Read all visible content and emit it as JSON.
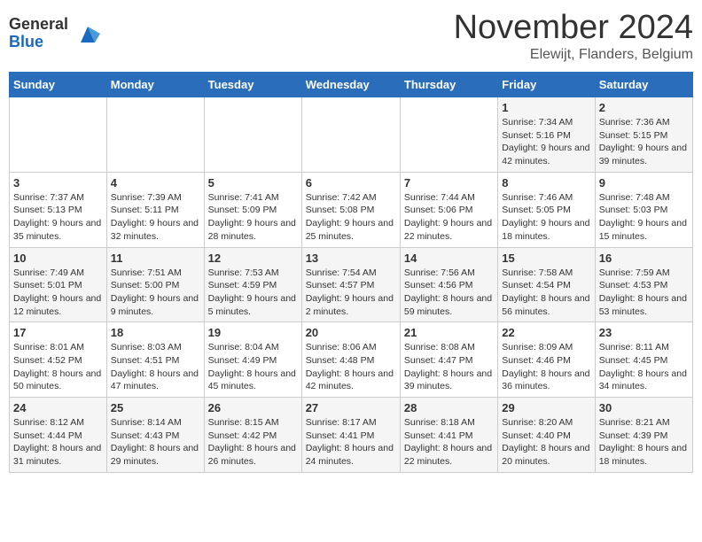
{
  "logo": {
    "text_general": "General",
    "text_blue": "Blue"
  },
  "header": {
    "month_year": "November 2024",
    "location": "Elewijt, Flanders, Belgium"
  },
  "weekdays": [
    "Sunday",
    "Monday",
    "Tuesday",
    "Wednesday",
    "Thursday",
    "Friday",
    "Saturday"
  ],
  "weeks": [
    [
      {
        "day": "",
        "info": ""
      },
      {
        "day": "",
        "info": ""
      },
      {
        "day": "",
        "info": ""
      },
      {
        "day": "",
        "info": ""
      },
      {
        "day": "",
        "info": ""
      },
      {
        "day": "1",
        "info": "Sunrise: 7:34 AM\nSunset: 5:16 PM\nDaylight: 9 hours and 42 minutes."
      },
      {
        "day": "2",
        "info": "Sunrise: 7:36 AM\nSunset: 5:15 PM\nDaylight: 9 hours and 39 minutes."
      }
    ],
    [
      {
        "day": "3",
        "info": "Sunrise: 7:37 AM\nSunset: 5:13 PM\nDaylight: 9 hours and 35 minutes."
      },
      {
        "day": "4",
        "info": "Sunrise: 7:39 AM\nSunset: 5:11 PM\nDaylight: 9 hours and 32 minutes."
      },
      {
        "day": "5",
        "info": "Sunrise: 7:41 AM\nSunset: 5:09 PM\nDaylight: 9 hours and 28 minutes."
      },
      {
        "day": "6",
        "info": "Sunrise: 7:42 AM\nSunset: 5:08 PM\nDaylight: 9 hours and 25 minutes."
      },
      {
        "day": "7",
        "info": "Sunrise: 7:44 AM\nSunset: 5:06 PM\nDaylight: 9 hours and 22 minutes."
      },
      {
        "day": "8",
        "info": "Sunrise: 7:46 AM\nSunset: 5:05 PM\nDaylight: 9 hours and 18 minutes."
      },
      {
        "day": "9",
        "info": "Sunrise: 7:48 AM\nSunset: 5:03 PM\nDaylight: 9 hours and 15 minutes."
      }
    ],
    [
      {
        "day": "10",
        "info": "Sunrise: 7:49 AM\nSunset: 5:01 PM\nDaylight: 9 hours and 12 minutes."
      },
      {
        "day": "11",
        "info": "Sunrise: 7:51 AM\nSunset: 5:00 PM\nDaylight: 9 hours and 9 minutes."
      },
      {
        "day": "12",
        "info": "Sunrise: 7:53 AM\nSunset: 4:59 PM\nDaylight: 9 hours and 5 minutes."
      },
      {
        "day": "13",
        "info": "Sunrise: 7:54 AM\nSunset: 4:57 PM\nDaylight: 9 hours and 2 minutes."
      },
      {
        "day": "14",
        "info": "Sunrise: 7:56 AM\nSunset: 4:56 PM\nDaylight: 8 hours and 59 minutes."
      },
      {
        "day": "15",
        "info": "Sunrise: 7:58 AM\nSunset: 4:54 PM\nDaylight: 8 hours and 56 minutes."
      },
      {
        "day": "16",
        "info": "Sunrise: 7:59 AM\nSunset: 4:53 PM\nDaylight: 8 hours and 53 minutes."
      }
    ],
    [
      {
        "day": "17",
        "info": "Sunrise: 8:01 AM\nSunset: 4:52 PM\nDaylight: 8 hours and 50 minutes."
      },
      {
        "day": "18",
        "info": "Sunrise: 8:03 AM\nSunset: 4:51 PM\nDaylight: 8 hours and 47 minutes."
      },
      {
        "day": "19",
        "info": "Sunrise: 8:04 AM\nSunset: 4:49 PM\nDaylight: 8 hours and 45 minutes."
      },
      {
        "day": "20",
        "info": "Sunrise: 8:06 AM\nSunset: 4:48 PM\nDaylight: 8 hours and 42 minutes."
      },
      {
        "day": "21",
        "info": "Sunrise: 8:08 AM\nSunset: 4:47 PM\nDaylight: 8 hours and 39 minutes."
      },
      {
        "day": "22",
        "info": "Sunrise: 8:09 AM\nSunset: 4:46 PM\nDaylight: 8 hours and 36 minutes."
      },
      {
        "day": "23",
        "info": "Sunrise: 8:11 AM\nSunset: 4:45 PM\nDaylight: 8 hours and 34 minutes."
      }
    ],
    [
      {
        "day": "24",
        "info": "Sunrise: 8:12 AM\nSunset: 4:44 PM\nDaylight: 8 hours and 31 minutes."
      },
      {
        "day": "25",
        "info": "Sunrise: 8:14 AM\nSunset: 4:43 PM\nDaylight: 8 hours and 29 minutes."
      },
      {
        "day": "26",
        "info": "Sunrise: 8:15 AM\nSunset: 4:42 PM\nDaylight: 8 hours and 26 minutes."
      },
      {
        "day": "27",
        "info": "Sunrise: 8:17 AM\nSunset: 4:41 PM\nDaylight: 8 hours and 24 minutes."
      },
      {
        "day": "28",
        "info": "Sunrise: 8:18 AM\nSunset: 4:41 PM\nDaylight: 8 hours and 22 minutes."
      },
      {
        "day": "29",
        "info": "Sunrise: 8:20 AM\nSunset: 4:40 PM\nDaylight: 8 hours and 20 minutes."
      },
      {
        "day": "30",
        "info": "Sunrise: 8:21 AM\nSunset: 4:39 PM\nDaylight: 8 hours and 18 minutes."
      }
    ]
  ]
}
